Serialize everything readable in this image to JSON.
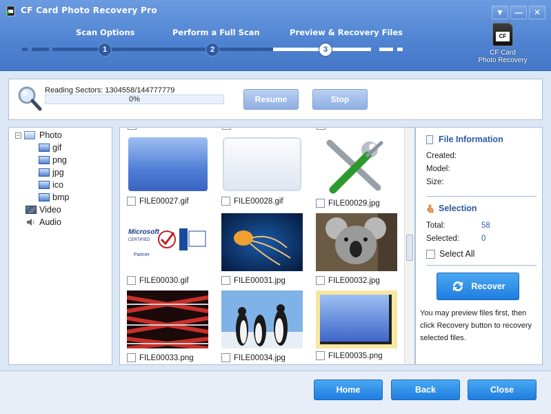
{
  "window": {
    "title": "CF Card Photo Recovery Pro",
    "buttons": [
      "▼",
      "—",
      "✕"
    ]
  },
  "wizard": {
    "steps": [
      {
        "number": "1",
        "label": "Scan Options"
      },
      {
        "number": "2",
        "label": "Perform a Full Scan"
      },
      {
        "number": "3",
        "label": "Preview & Recovery Files"
      }
    ],
    "active_step": 3
  },
  "logo": {
    "card_text": "CF",
    "line1": "CF Card",
    "line2": "Photo Recovery"
  },
  "scan": {
    "reading_label": "Reading Sectors: 1304558/144777779",
    "percent_text": "0%",
    "progress": 0,
    "resume_label": "Resume",
    "stop_label": "Stop"
  },
  "tree": {
    "root": "Photo",
    "photo_types": [
      "gif",
      "png",
      "jpg",
      "ico",
      "bmp"
    ],
    "others": [
      "Video",
      "Audio"
    ]
  },
  "files": [
    {
      "name": "FILE00027.gif",
      "thumb": "blue-gradient"
    },
    {
      "name": "FILE00028.gif",
      "thumb": "light-panel"
    },
    {
      "name": "FILE00029.jpg",
      "thumb": "tools"
    },
    {
      "name": "FILE00030.gif",
      "thumb": "certification-logos"
    },
    {
      "name": "FILE00031.jpg",
      "thumb": "jellyfish"
    },
    {
      "name": "FILE00032.jpg",
      "thumb": "koala"
    },
    {
      "name": "FILE00033.png",
      "thumb": "red-pattern"
    },
    {
      "name": "FILE00034.jpg",
      "thumb": "penguins"
    },
    {
      "name": "FILE00035.png",
      "thumb": "blue-box"
    }
  ],
  "info": {
    "file_info_title": "File Information",
    "created_label": "Created:",
    "model_label": "Model:",
    "size_label": "Size:",
    "selection_title": "Selection",
    "total_label": "Total:",
    "total_value": "58",
    "selected_label": "Selected:",
    "selected_value": "0",
    "select_all_label": "Select All",
    "recover_label": "Recover",
    "hint": "You may preview files first, then click Recovery button to recovery selected files."
  },
  "footer": {
    "home_label": "Home",
    "back_label": "Back",
    "close_label": "Close"
  },
  "colors": {
    "header": "#4f83d1",
    "button": "#1f7de0",
    "accent_text": "#2b58a0"
  }
}
